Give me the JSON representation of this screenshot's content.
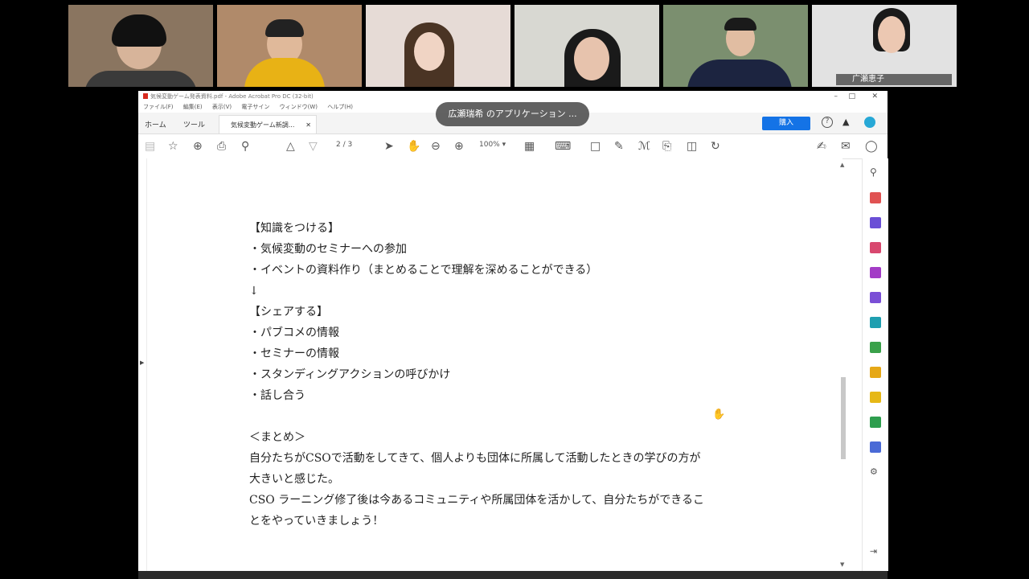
{
  "participants": [
    {
      "id": "p1",
      "bg": "#8a7560",
      "hair": "#111",
      "body": "#3a3a3a"
    },
    {
      "id": "p2",
      "bg": "#b08a6a",
      "hair": "#222",
      "body": "#e8b215"
    },
    {
      "id": "p3",
      "bg": "#e6dbd6",
      "hair": "#4a3424",
      "body": "#7a5a4a"
    },
    {
      "id": "p4",
      "bg": "#d8d8d2",
      "hair": "#1a1a1a",
      "body": "#222"
    },
    {
      "id": "p5",
      "bg": "#7b8f6f",
      "hair": "#1a1a1a",
      "body": "#1c2440"
    },
    {
      "id": "p6",
      "bg": "#e2e2e2",
      "hair": "#1a1a1a",
      "body": "#3a3a3a",
      "name": "广瀬恵子",
      "active": true
    }
  ],
  "toast": "広瀬瑞希 のアプリケーション ...",
  "window": {
    "title": "気候変動ゲーム発表資料.pdf - Adobe Acrobat Pro DC (32-bit)",
    "menu": [
      "ファイル(F)",
      "編集(E)",
      "表示(V)",
      "電子サイン",
      "ウィンドウ(W)",
      "ヘルプ(H)"
    ],
    "tabs": {
      "home": "ホーム",
      "tools": "ツール",
      "document": "気候変動ゲーム新調..."
    },
    "buy_label": "購入",
    "page_current": "2",
    "page_total": "/ 3",
    "zoom": "100%"
  },
  "document": {
    "lines": [
      "【知識をつける】",
      "・気候変動のセミナーへの参加",
      "・イベントの資料作り（まとめることで理解を深めることができる）",
      "↓",
      "【シェアする】",
      "・パブコメの情報",
      "・セミナーの情報",
      "・スタンディングアクションの呼びかけ",
      "・話し合う",
      "",
      "＜まとめ＞",
      "自分たちがCSOで活動をしてきて、個人よりも団体に所属して活動したときの学びの方が",
      "大きいと感じた。",
      "CSO ラーニング修了後は今あるコミュニティや所属団体を活かして、自分たちができるこ",
      "とをやっていきましょう！"
    ]
  },
  "colors": {
    "accent": "#1473e6",
    "active_outline": "#2eb3f0",
    "pdf_red": "#d82b20"
  }
}
